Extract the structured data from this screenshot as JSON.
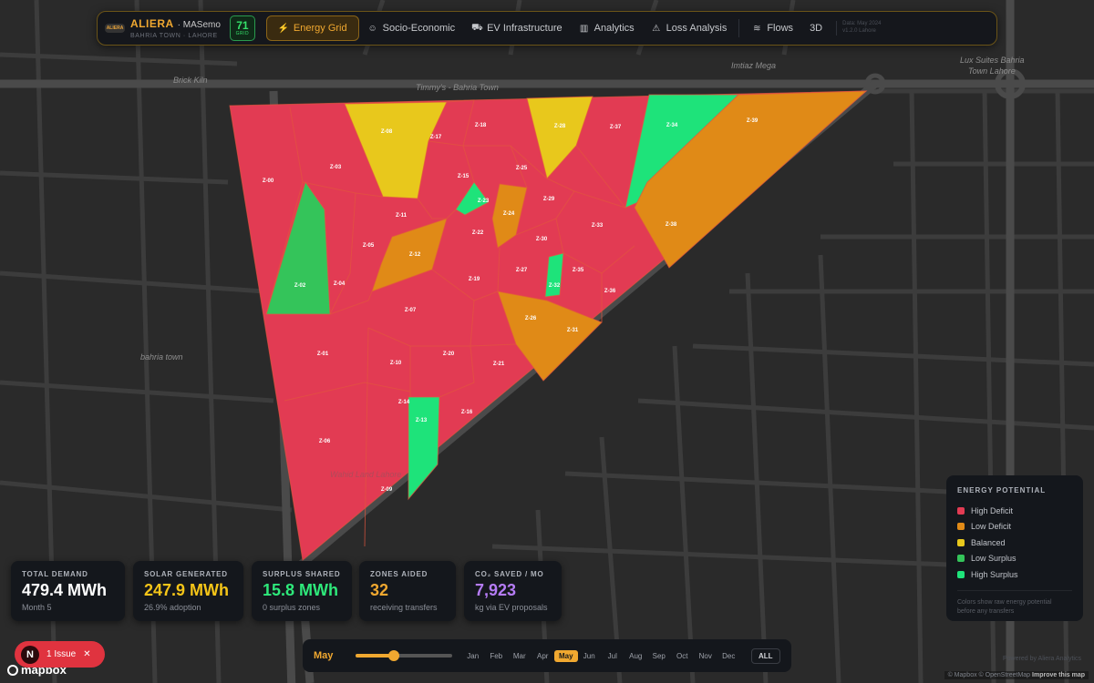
{
  "header": {
    "brand_name": "ALIERA",
    "brand_sub": "· MASemo",
    "brand_location": "BAHRIA TOWN · LAHORE",
    "brand_logo_text": "ALIERA",
    "grid_score": "71",
    "grid_score_label": "GRID",
    "nav": [
      {
        "label": "Energy Grid",
        "icon": "bolt-icon",
        "active": true
      },
      {
        "label": "Socio-Economic",
        "icon": "users-icon"
      },
      {
        "label": "EV Infrastructure",
        "icon": "car-icon"
      },
      {
        "label": "Analytics",
        "icon": "bar-chart-icon"
      },
      {
        "label": "Loss Analysis",
        "icon": "warning-icon"
      }
    ],
    "flows_label": "Flows",
    "three_d_label": "3D",
    "date_line1": "Data: May 2024",
    "date_line2": "v1.2.0 Lahore"
  },
  "map": {
    "road_labels": [
      "Brick Kiln",
      "Timmy's - Bahria Town",
      "Imtiaz Mega",
      "Lux Suites Bahria",
      "Town Lahore",
      "bahria town",
      "Wahid Land Lahore"
    ],
    "zones": [
      "Z-00",
      "Z-01",
      "Z-02",
      "Z-03",
      "Z-04",
      "Z-05",
      "Z-06",
      "Z-07",
      "Z-08",
      "Z-09",
      "Z-10",
      "Z-11",
      "Z-12",
      "Z-13",
      "Z-14",
      "Z-15",
      "Z-16",
      "Z-17",
      "Z-18",
      "Z-19",
      "Z-20",
      "Z-21",
      "Z-22",
      "Z-23",
      "Z-24",
      "Z-25",
      "Z-26",
      "Z-27",
      "Z-28",
      "Z-29",
      "Z-30",
      "Z-31",
      "Z-32",
      "Z-33",
      "Z-34",
      "Z-35",
      "Z-36",
      "Z-37",
      "Z-38",
      "Z-39"
    ]
  },
  "stats": [
    {
      "label": "TOTAL DEMAND",
      "value": "479.4 MWh",
      "sub": "Month 5",
      "color": "#ffffff"
    },
    {
      "label": "SOLAR GENERATED",
      "value": "247.9 MWh",
      "sub": "26.9% adoption",
      "color": "#f5c518"
    },
    {
      "label": "SURPLUS SHARED",
      "value": "15.8 MWh",
      "sub": "0 surplus zones",
      "color": "#2ee87a"
    },
    {
      "label": "ZONES AIDED",
      "value": "32",
      "sub": "receiving transfers",
      "color": "#f0a830"
    },
    {
      "label": "CO₂ SAVED / MO",
      "value": "7,923",
      "sub": "kg via EV proposals",
      "color": "#b57cf5"
    }
  ],
  "legend": {
    "title": "ENERGY POTENTIAL",
    "items": [
      {
        "label": "High Deficit",
        "color": "#e23b53"
      },
      {
        "label": "Low Deficit",
        "color": "#e08a17"
      },
      {
        "label": "Balanced",
        "color": "#e8c81c"
      },
      {
        "label": "Low Surplus",
        "color": "#34c45a"
      },
      {
        "label": "High Surplus",
        "color": "#1ee37a"
      }
    ],
    "note_line1": "Colors show raw energy potential",
    "note_line2": "before any transfers"
  },
  "timeline": {
    "current": "May",
    "progress": 0.4,
    "months": [
      "Jan",
      "Feb",
      "Mar",
      "Apr",
      "May",
      "Jun",
      "Jul",
      "Aug",
      "Sep",
      "Oct",
      "Nov",
      "Dec"
    ],
    "active_month": "May",
    "all_label": "ALL"
  },
  "issue": {
    "letter": "N",
    "label": "1 Issue"
  },
  "mapbox_logo": "mapbox",
  "attribution": {
    "mapbox": "© Mapbox",
    "osm": "© OpenStreetMap",
    "improve": "Improve this map"
  },
  "powered_by": "Powered by Aliera Analytics"
}
